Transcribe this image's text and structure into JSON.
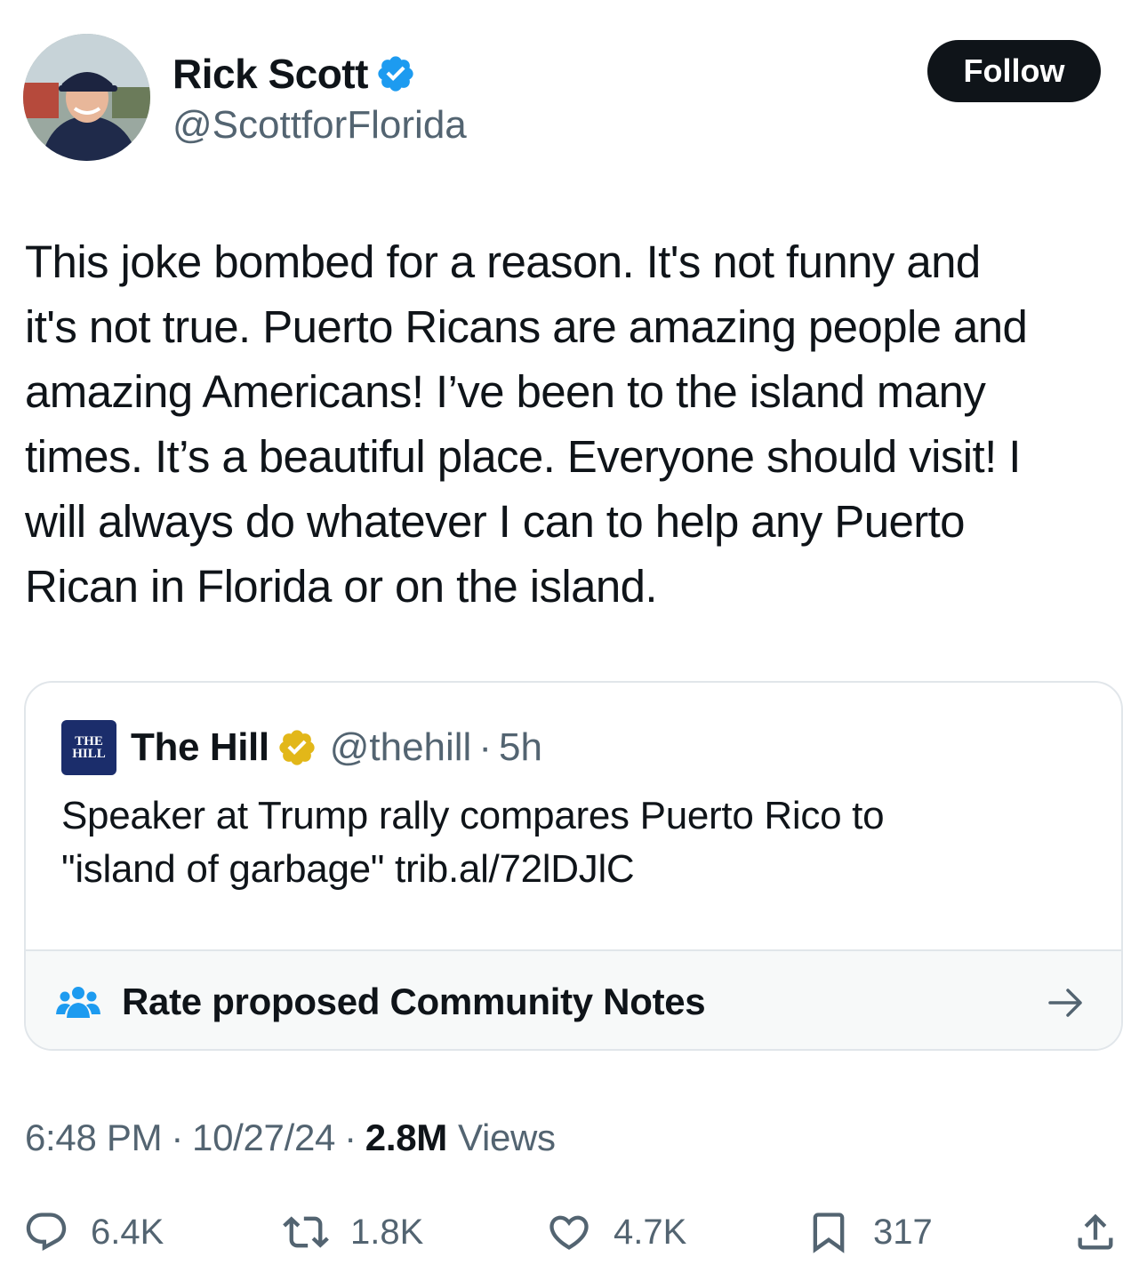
{
  "author": {
    "display_name": "Rick Scott",
    "handle": "@ScottforFlorida",
    "verified_badge": "blue-check-icon",
    "follow_label": "Follow"
  },
  "tweet": {
    "text": "This joke bombed for a reason. It's not funny and\nit's not true. Puerto Ricans are amazing people and\namazing Americans! I’ve been to the island many\ntimes. It’s a beautiful place. Everyone should visit! I\nwill always do whatever I can to help any Puerto\nRican in Florida or on the island."
  },
  "quoted": {
    "logo_text_top": "THE",
    "logo_text_bottom": "HILL",
    "name": "The Hill",
    "badge": "gold-check-icon",
    "handle": "@thehill",
    "separator": "·",
    "age": "5h",
    "text": "Speaker at Trump rally compares Puerto Rico to\n\"island of garbage\" trib.al/72lDJlC",
    "notes_label": "Rate proposed Community Notes"
  },
  "meta": {
    "time": "6:48 PM",
    "separator": "·",
    "date": "10/27/24",
    "views_count": "2.8M",
    "views_label": "Views"
  },
  "actions": {
    "replies": "6.4K",
    "reposts": "1.8K",
    "likes": "4.7K",
    "bookmarks": "317"
  },
  "colors": {
    "text": "#0f1419",
    "secondary": "#536471",
    "verified_blue": "#1d9bf0",
    "gold": "#e2b719",
    "border": "#e1e6ea"
  }
}
